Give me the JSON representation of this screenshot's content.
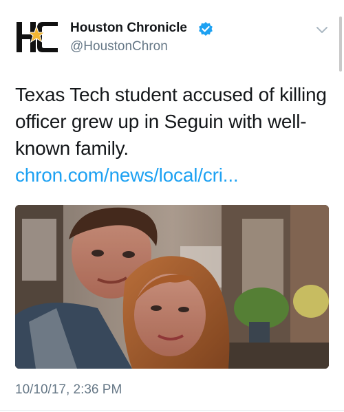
{
  "author": {
    "logo_text": "HC",
    "name": "Houston Chronicle",
    "handle": "@HoustonChron",
    "verified": true
  },
  "tweet": {
    "text": "Texas Tech student accused of killing officer grew up in Seguin with well-known family. ",
    "link": "chron.com/news/local/cri...",
    "timestamp": "10/10/17, 2:36 PM"
  },
  "icons": {
    "logo": "houston-chronicle-logo",
    "verified": "verified-badge-icon",
    "menu": "chevron-down-icon"
  },
  "colors": {
    "link": "#1da1f2",
    "secondary_text": "#657786",
    "verified": "#1da1f2"
  }
}
